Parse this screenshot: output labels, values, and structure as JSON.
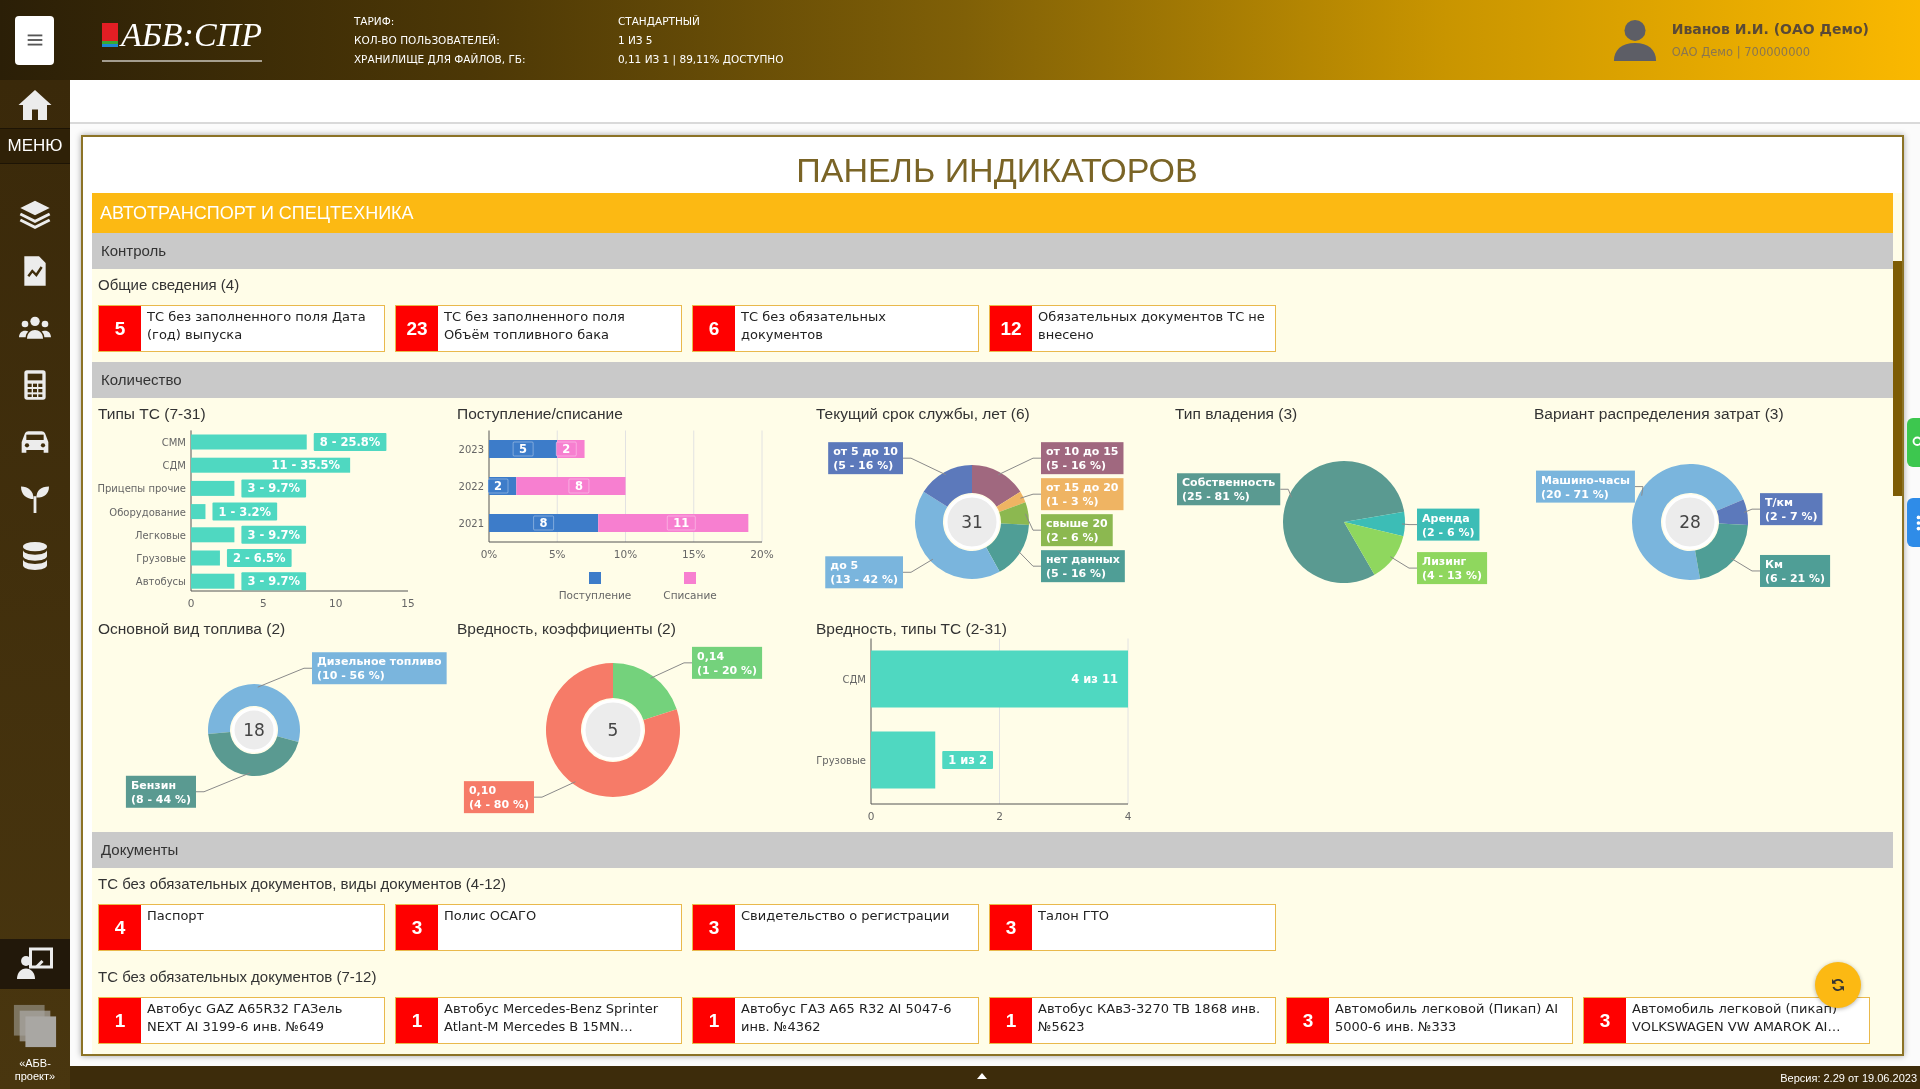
{
  "header": {
    "logo": "АБВ:СПР",
    "info": [
      {
        "label": "ТАРИФ:",
        "value": "СТАНДАРТНЫЙ"
      },
      {
        "label": "КОЛ-ВО ПОЛЬЗОВАТЕЛЕЙ:",
        "value": "1 ИЗ 5"
      },
      {
        "label": "ХРАНИЛИЩЕ ДЛЯ ФАЙЛОВ, ГБ:",
        "value": "0,11 ИЗ 1 | 89,11% ДОСТУПНО"
      }
    ],
    "user": {
      "name": "Иванов И.И. (ОАО Демо)",
      "org": "ОАО Демо | 700000000"
    }
  },
  "sidebar": {
    "menu_label": "МЕНЮ",
    "footer": "«АБВ-проект»"
  },
  "page_title": "ПАНЕЛЬ ИНДИКАТОРОВ",
  "section": {
    "title": "АВТОТРАНСПОРТ И СПЕЦТЕХНИКА",
    "groups": [
      {
        "title": "Контроль",
        "blocks": [
          {
            "kind": "cards",
            "title": "Общие сведения (4)",
            "cards": [
              {
                "count": "5",
                "text": "ТС без заполненного поля Дата (год) выпуска"
              },
              {
                "count": "23",
                "text": "ТС без заполненного поля Объём топливного бака"
              },
              {
                "count": "6",
                "text": "ТС без обязательных документов"
              },
              {
                "count": "12",
                "text": "Обязательных документов ТС не внесено"
              }
            ]
          }
        ]
      },
      {
        "title": "Количество",
        "blocks": [
          {
            "kind": "charts",
            "charts": [
              {
                "title": "Типы ТС (7-31)",
                "chart_data": {
                  "type": "bar",
                  "orientation": "horizontal",
                  "categories": [
                    "СММ",
                    "СДМ",
                    "Прицепы прочие",
                    "Оборудование",
                    "Легковые",
                    "Грузовые",
                    "Автобусы"
                  ],
                  "values": [
                    8,
                    11,
                    3,
                    1,
                    3,
                    2,
                    3
                  ],
                  "value_labels": [
                    "8 - 25.8%",
                    "11 - 35.5%",
                    "3 - 9.7%",
                    "1 - 3.2%",
                    "3 - 9.7%",
                    "2 - 6.5%",
                    "3 - 9.7%"
                  ],
                  "xlim": [
                    0,
                    15
                  ],
                  "xticks": [
                    0,
                    5,
                    10,
                    15
                  ]
                }
              },
              {
                "title": "Поступление/списание",
                "chart_data": {
                  "type": "bar",
                  "orientation": "horizontal",
                  "stacked": true,
                  "grid": true,
                  "legend": true,
                  "categories": [
                    "2023",
                    "2022",
                    "2021"
                  ],
                  "series": [
                    {
                      "name": "Поступление",
                      "color": "#3d7cc9",
                      "values": [
                        5,
                        2,
                        8
                      ]
                    },
                    {
                      "name": "Списание",
                      "color": "#f77fd0",
                      "values": [
                        2,
                        8,
                        11
                      ]
                    }
                  ],
                  "xlim": [
                    0,
                    20
                  ],
                  "xticks": [
                    {
                      "value": 0,
                      "label": "0%"
                    },
                    {
                      "value": 5,
                      "label": "5%"
                    },
                    {
                      "value": 10,
                      "label": "10%"
                    },
                    {
                      "value": 15,
                      "label": "15%"
                    },
                    {
                      "value": 20,
                      "label": "20%"
                    }
                  ],
                  "data_labels": true
                }
              },
              {
                "title": "Текущий срок службы, лет (6)",
                "chart_data": {
                  "type": "donut",
                  "categories": [
                    "от 10 до 15",
                    "от 15 до 20",
                    "свыше 20",
                    "нет данных",
                    "до 5",
                    "от 5 до 10"
                  ],
                  "values": [
                    5,
                    1,
                    2,
                    5,
                    13,
                    5
                  ],
                  "colors": [
                    "#a0687f",
                    "#efb463",
                    "#8cb850",
                    "#4f9e96",
                    "#7ab5dd",
                    "#5c79bb"
                  ],
                  "value_labels": [
                    "(5 - 16 %)",
                    "(1 - 3 %)",
                    "(2 - 6 %)",
                    "(5 - 16 %)",
                    "(13 - 42 %)",
                    "(5 - 16 %)"
                  ],
                  "annotations": [
                    {
                      "text": "31"
                    }
                  ]
                }
              },
              {
                "title": "Тип владения (3)",
                "chart_data": {
                  "type": "pie",
                  "categories": [
                    "Собственность",
                    "Аренда",
                    "Лизинг"
                  ],
                  "values": [
                    25,
                    2,
                    4
                  ],
                  "colors": [
                    "#5a9a91",
                    "#3cbdb6",
                    "#8fd75e"
                  ],
                  "value_labels": [
                    "(25 - 81 %)",
                    "(2 - 6 %)",
                    "(4 - 13 %)"
                  ]
                }
              },
              {
                "title": "Вариант распределения затрат (3)",
                "chart_data": {
                  "type": "donut",
                  "categories": [
                    "Машино-часы",
                    "Т/км",
                    "Км"
                  ],
                  "values": [
                    20,
                    2,
                    6
                  ],
                  "colors": [
                    "#7ab5dd",
                    "#5c79bb",
                    "#4f9e96"
                  ],
                  "value_labels": [
                    "(20 - 71 %)",
                    "(2 - 7 %)",
                    "(6 - 21 %)"
                  ],
                  "annotations": [
                    {
                      "text": "28"
                    }
                  ]
                }
              },
              {
                "title": "Основной вид топлива (2)",
                "chart_data": {
                  "type": "donut",
                  "categories": [
                    "Дизельное топливо",
                    "Бензин"
                  ],
                  "values": [
                    10,
                    8
                  ],
                  "colors": [
                    "#7ab5dd",
                    "#5a9a91"
                  ],
                  "value_labels": [
                    "(10 - 56 %)",
                    "(8 - 44 %)"
                  ],
                  "annotations": [
                    {
                      "text": "18"
                    }
                  ]
                }
              },
              {
                "title": "Вредность, коэффициенты (2)",
                "chart_data": {
                  "type": "donut",
                  "categories": [
                    "0,14",
                    "0,10"
                  ],
                  "values": [
                    1,
                    4
                  ],
                  "colors": [
                    "#74d27c",
                    "#f67b68"
                  ],
                  "value_labels": [
                    "(1 - 20 %)",
                    "(4 - 80 %)"
                  ],
                  "annotations": [
                    {
                      "text": "5"
                    }
                  ]
                }
              },
              {
                "title": "Вредность, типы ТС (2-31)",
                "chart_data": {
                  "type": "bar",
                  "orientation": "horizontal",
                  "categories": [
                    "СДМ",
                    "Грузовые"
                  ],
                  "values": [
                    4,
                    1
                  ],
                  "value_labels": [
                    "4 из 11",
                    "1 из 2"
                  ],
                  "grid": true,
                  "xlim": [
                    0,
                    4
                  ],
                  "xticks": [
                    0,
                    2,
                    4
                  ]
                }
              }
            ]
          }
        ]
      },
      {
        "title": "Документы",
        "blocks": [
          {
            "kind": "cards",
            "title": "ТС без обязательных документов, виды документов (4-12)",
            "cards": [
              {
                "count": "4",
                "text": "Паспорт"
              },
              {
                "count": "3",
                "text": "Полис ОСАГО"
              },
              {
                "count": "3",
                "text": "Свидетельство о регистрации"
              },
              {
                "count": "3",
                "text": "Талон ГТО"
              }
            ]
          },
          {
            "kind": "cards",
            "title": "ТС без обязательных документов (7-12)",
            "cards": [
              {
                "count": "1",
                "text": "Автобус GAZ A65R32 ГАЗель NEXT AI 3199-6 инв. №649"
              },
              {
                "count": "1",
                "text": "Автобус Mercedes-Benz Sprinter Atlant-M Mercedes B 15MN…"
              },
              {
                "count": "1",
                "text": "Автобус ГАЗ А65 R32 AI 5047-6 инв. №4362"
              },
              {
                "count": "1",
                "text": "Автобус КАвЗ-3270 ТВ 1868 инв. №5623"
              },
              {
                "count": "3",
                "text": "Автомобиль легковой (Пикап) AI 5000-6 инв. №333"
              },
              {
                "count": "3",
                "text": "Автомобиль легковой (пикап) VOLKSWAGEN VW AMAROK AI…"
              }
            ]
          }
        ]
      }
    ]
  },
  "status_bar": {
    "version": "Версия: 2.29 от 19.06.2023"
  }
}
